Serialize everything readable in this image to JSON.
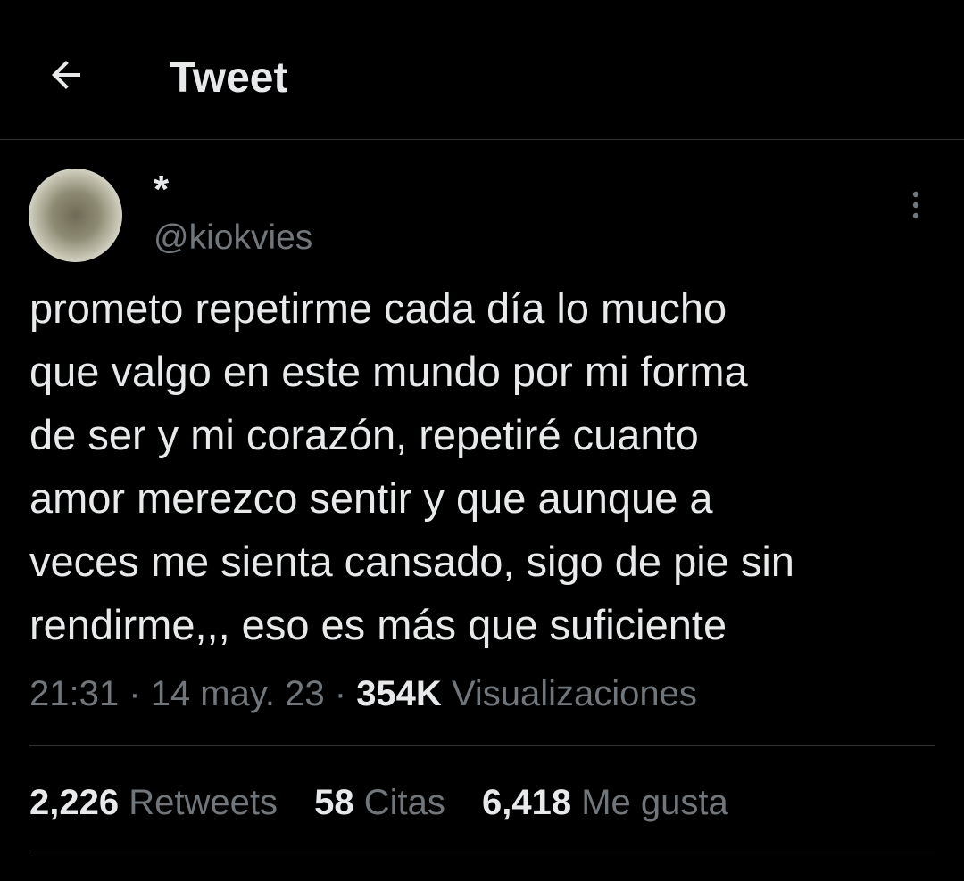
{
  "header": {
    "title": "Tweet",
    "back_icon": "arrow-left-icon"
  },
  "author": {
    "display_name": "*",
    "handle": "@kiokvies",
    "more_icon": "vertical-ellipsis-icon"
  },
  "tweet": {
    "text": "prometo repetirme cada día lo mucho\nque valgo en este mundo por mi forma\nde ser y mi corazón, repetiré cuanto\namor merezco sentir y que aunque a\nveces me sienta cansado, sigo de pie sin\nrendirme,,, eso es más que suficiente",
    "time": "21:31",
    "date": "14 may. 23",
    "separator": "·",
    "views_count": "354K",
    "views_label": "Visualizaciones"
  },
  "stats": {
    "retweets": {
      "count": "2,226",
      "label": "Retweets"
    },
    "quotes": {
      "count": "58",
      "label": "Citas"
    },
    "likes": {
      "count": "6,418",
      "label": "Me gusta"
    }
  },
  "colors": {
    "background": "#000000",
    "primary_text": "#e7e9ea",
    "secondary_text": "#71767b",
    "divider": "#2f3336"
  }
}
